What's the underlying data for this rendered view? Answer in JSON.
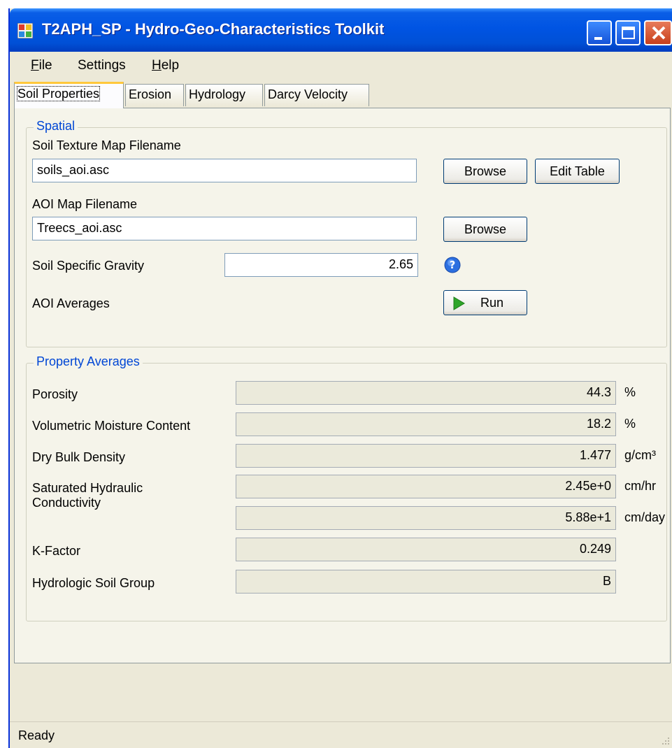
{
  "window": {
    "title": "T2APH_SP - Hydro-Geo-Characteristics Toolkit"
  },
  "menu": [
    {
      "label": "File"
    },
    {
      "label": "Settings"
    },
    {
      "label": "Help"
    }
  ],
  "tabs": [
    {
      "label": "Soil Properties",
      "active": true
    },
    {
      "label": "Erosion"
    },
    {
      "label": "Hydrology"
    },
    {
      "label": "Darcy Velocity"
    }
  ],
  "spatial": {
    "title": "Spatial",
    "soil_texture_label": "Soil Texture Map Filename",
    "soil_texture_value": "soils_aoi.asc",
    "browse_label": "Browse",
    "edit_table_label": "Edit Table",
    "aoi_label": "AOI Map Filename",
    "aoi_value": "Treecs_aoi.asc",
    "gravity_label": "Soil Specific Gravity",
    "gravity_value": "2.65",
    "averages_label": "AOI Averages",
    "run_label": "Run"
  },
  "property_averages": {
    "title": "Property Averages",
    "porosity_label": "Porosity",
    "porosity_value": "44.3",
    "porosity_unit": "%",
    "vmc_label": "Volumetric Moisture Content",
    "vmc_value": "18.2",
    "vmc_unit": "%",
    "density_label": "Dry Bulk Density",
    "density_value": "1.477",
    "density_unit": "g/cm³",
    "ksat_label_1": "Saturated Hydraulic",
    "ksat_label_2": "Conductivity",
    "ksat_hr_value": "2.45e+0",
    "ksat_hr_unit": "cm/hr",
    "ksat_day_value": "5.88e+1",
    "ksat_day_unit": "cm/day",
    "kfactor_label": "K-Factor",
    "kfactor_value": "0.249",
    "hsg_label": "Hydrologic Soil Group",
    "hsg_value": "B"
  },
  "status": {
    "text": "Ready"
  },
  "icons": {
    "app": "app-window-icon",
    "help": "help-question-icon",
    "run": "play-arrow-icon"
  },
  "colors": {
    "titlebar": "#0054e3",
    "group_title": "#0046d5",
    "tab_highlight": "#ffc83c",
    "run_arrow": "#2fa52a"
  }
}
